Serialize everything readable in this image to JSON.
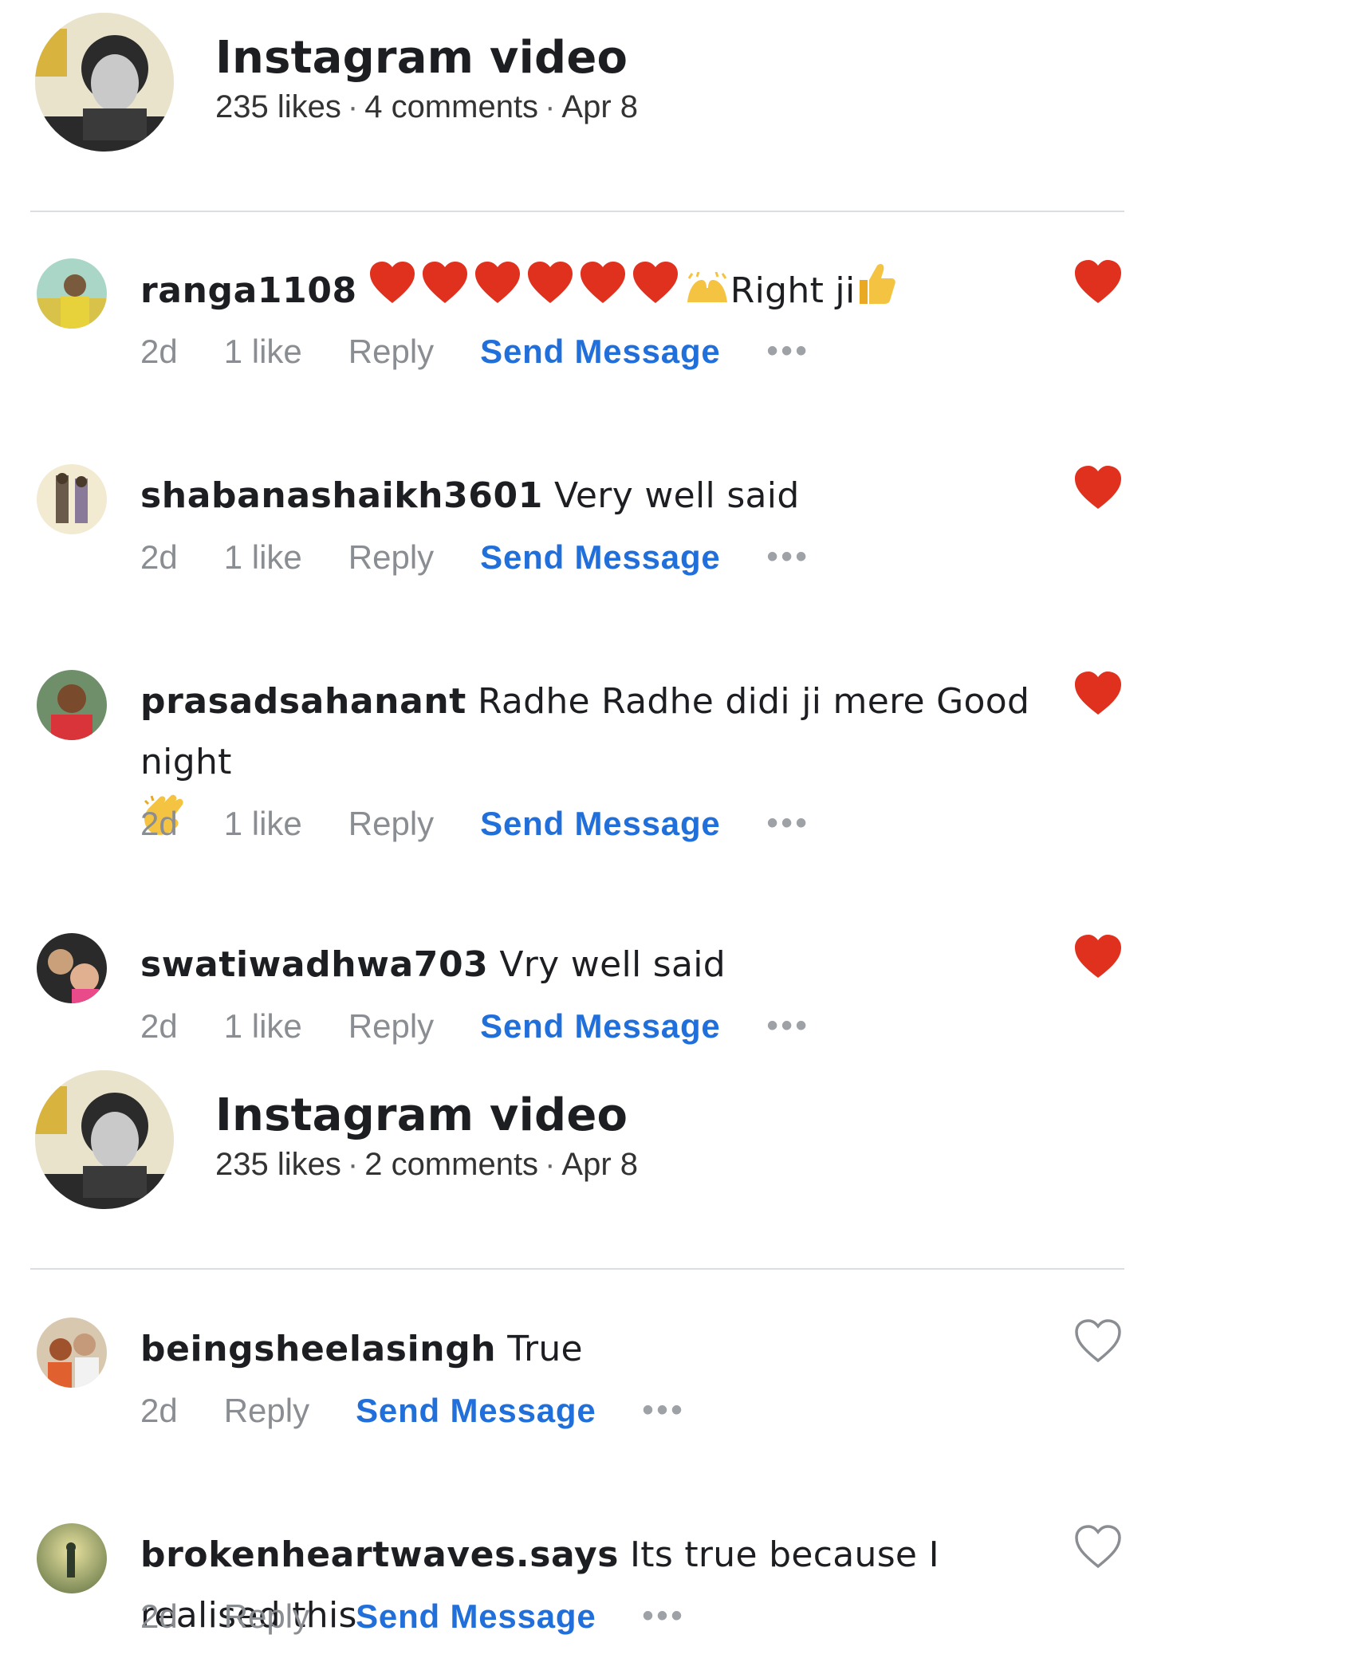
{
  "posts": [
    {
      "title": "Instagram video",
      "likes": "235 likes",
      "comments_count": "4 comments",
      "date": "Apr 8",
      "comments": [
        {
          "user": "ranga1108",
          "text": "Right ji",
          "age": "2d",
          "likes": "1 like",
          "reply": "Reply",
          "send": "Send Message",
          "more": "•••",
          "liked": true
        },
        {
          "user": "shabanashaikh3601",
          "text": "Very well said",
          "age": "2d",
          "likes": "1 like",
          "reply": "Reply",
          "send": "Send Message",
          "more": "•••",
          "liked": true
        },
        {
          "user": "prasadsahanant",
          "text": "Radhe Radhe didi ji mere Good night",
          "age": "2d",
          "likes": "1 like",
          "reply": "Reply",
          "send": "Send Message",
          "more": "•••",
          "liked": true
        },
        {
          "user": "swatiwadhwa703",
          "text": "Vry well said",
          "age": "2d",
          "likes": "1 like",
          "reply": "Reply",
          "send": "Send Message",
          "more": "•••",
          "liked": true
        }
      ]
    },
    {
      "title": "Instagram video",
      "likes": "235 likes",
      "comments_count": "2 comments",
      "date": "Apr 8",
      "comments": [
        {
          "user": "beingsheelasingh",
          "text": "True",
          "age": "2d",
          "reply": "Reply",
          "send": "Send Message",
          "more": "•••",
          "liked": false
        },
        {
          "user": "brokenheartwaves.says",
          "text": "Its true because I realised this",
          "age": "2d",
          "reply": "Reply",
          "send": "Send Message",
          "more": "•••",
          "liked": false
        }
      ]
    }
  ],
  "colors": {
    "heart_filled": "#e0301e",
    "link_blue": "#216fdb",
    "meta_gray": "#8a8d91"
  }
}
